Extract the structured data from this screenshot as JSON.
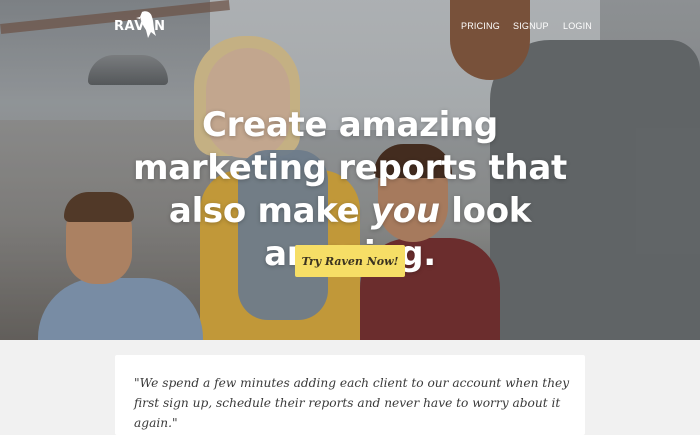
{
  "header": {
    "logo_text": "RAVEN",
    "nav": [
      {
        "label": "PRICING"
      },
      {
        "label": "SIGNUP"
      },
      {
        "label": "LOGIN"
      }
    ]
  },
  "hero": {
    "headline_part1": "Create amazing marketing reports that also make ",
    "headline_emphasis": "you",
    "headline_part2": " look amazing.",
    "cta_label": "Try Raven Now!"
  },
  "testimonial": {
    "quote": "\"We spend a few minutes adding each client to our account when they first sign up, schedule their reports and never have to worry about it again.\""
  },
  "colors": {
    "cta_background": "#f6de66",
    "page_background": "#f1f1f1",
    "card_background": "#ffffff"
  }
}
